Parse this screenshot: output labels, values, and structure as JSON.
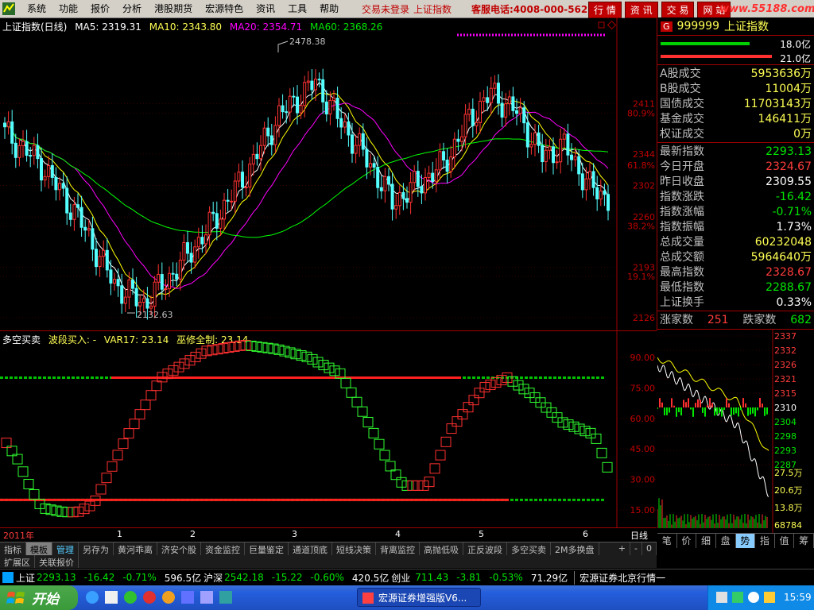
{
  "menu": {
    "items": [
      "系统",
      "功能",
      "报价",
      "分析",
      "港股期货",
      "宏源特色",
      "资讯",
      "工具",
      "帮助"
    ],
    "login_status": "交易未登录",
    "index_name": "上证指数",
    "service_phone": "客服电话:4008-000-562",
    "nav_buttons": [
      "行 情",
      "资 讯",
      "交 易",
      "网 站"
    ],
    "site": "www.55188.com"
  },
  "main_chart": {
    "legend": {
      "name": "上证指数(日线)",
      "ma5": "MA5: 2319.31",
      "ma10": "MA10: 2343.80",
      "ma20": "MA20: 2354.71",
      "ma60": "MA60: 2368.26"
    },
    "annot_high": "2478.38",
    "annot_low": "2132.63",
    "y_ticks": [
      {
        "label": "2411",
        "value": 2411
      },
      {
        "label": "80.9%",
        "value": 2398
      },
      {
        "label": "2344",
        "value": 2344
      },
      {
        "label": "61.8%",
        "value": 2329
      },
      {
        "label": "2302",
        "value": 2302
      },
      {
        "label": "2260",
        "value": 2260
      },
      {
        "label": "38.2%",
        "value": 2248
      },
      {
        "label": "2193",
        "value": 2193
      },
      {
        "label": "19.1%",
        "value": 2181
      },
      {
        "label": "2126",
        "value": 2126
      }
    ],
    "colors": {
      "up": "#ff3232",
      "down": "#54ffff",
      "ma5": "#ffffff",
      "ma10": "#ffff00",
      "ma20": "#ff00ff",
      "ma60": "#00ff00"
    }
  },
  "sub_chart": {
    "legend": {
      "name": "多空买卖",
      "b1": "波段买入: -",
      "var17": "VAR17: 23.14",
      "wu": "巫修全制: 23.14"
    },
    "y_ticks": [
      {
        "label": "90.00",
        "value": 90
      },
      {
        "label": "75.00",
        "value": 75
      },
      {
        "label": "60.00",
        "value": 60
      },
      {
        "label": "45.00",
        "value": 45
      },
      {
        "label": "30.00",
        "value": 30
      },
      {
        "label": "15.00",
        "value": 15
      }
    ]
  },
  "x_labels": [
    "2011年",
    "1",
    "2",
    "3",
    "4",
    "5",
    "6"
  ],
  "period": "日线",
  "zoom_buttons": [
    "+",
    "-",
    "0"
  ],
  "tabs": [
    "指标",
    "模板",
    "管理",
    "另存为",
    "黄河乖离",
    "济安个股",
    "资金监控",
    "巨量鉴定",
    "通道顶底",
    "短线决策",
    "背离监控",
    "高抛低吸",
    "正反波段",
    "多空买卖",
    "2M多换盘"
  ],
  "tabs2": [
    "扩展区",
    "关联报价"
  ],
  "right_panel": {
    "code_badge": "G",
    "code": "999999",
    "name": "上证指数",
    "bar1_value": "18.0亿",
    "bar2_value": "21.0亿",
    "rows_a": [
      {
        "k": "A股成交",
        "v": "5953636万",
        "c": "yellow"
      },
      {
        "k": "B股成交",
        "v": "11004万",
        "c": "yellow"
      },
      {
        "k": "国债成交",
        "v": "11703143万",
        "c": "yellow"
      },
      {
        "k": "基金成交",
        "v": "146411万",
        "c": "yellow"
      },
      {
        "k": "权证成交",
        "v": "0万",
        "c": "yellow"
      }
    ],
    "rows_b": [
      {
        "k": "最新指数",
        "v": "2293.13",
        "c": "green"
      },
      {
        "k": "今日开盘",
        "v": "2324.67",
        "c": "red"
      },
      {
        "k": "昨日收盘",
        "v": "2309.55",
        "c": "white"
      },
      {
        "k": "指数涨跌",
        "v": "-16.42",
        "c": "green"
      },
      {
        "k": "指数涨幅",
        "v": "-0.71%",
        "c": "green"
      },
      {
        "k": "指数振幅",
        "v": "1.73%",
        "c": "white"
      },
      {
        "k": "总成交量",
        "v": "60232048",
        "c": "yellow"
      },
      {
        "k": "总成交额",
        "v": "5964640万",
        "c": "yellow"
      },
      {
        "k": "最高指数",
        "v": "2328.67",
        "c": "red"
      },
      {
        "k": "最低指数",
        "v": "2288.67",
        "c": "green"
      },
      {
        "k": "上证换手",
        "v": "0.33%",
        "c": "white"
      }
    ],
    "up_label": "涨家数",
    "up_count": "251",
    "down_label": "跌家数",
    "down_count": "682",
    "mini_ticks": [
      "2337",
      "2332",
      "2326",
      "2321",
      "2315",
      "2310",
      "2304",
      "2298",
      "2293",
      "2287",
      "27.5万",
      "20.6万",
      "13.8万",
      "68784"
    ],
    "bottom_tabs": [
      "笔",
      "价",
      "细",
      "盘",
      "势",
      "指",
      "值",
      "筹"
    ]
  },
  "ticker": {
    "sh_name": "上证",
    "sh_val": "2293.13",
    "sh_chg": "-16.42",
    "sh_pct": "-0.71%",
    "sh_amt": "596.5亿",
    "hs_name": "沪深",
    "hs_val": "2542.18",
    "hs_chg": "-15.22",
    "hs_pct": "-0.60%",
    "hs_amt": "420.5亿",
    "cy_name": "创业",
    "cy_val": "711.43",
    "cy_chg": "-3.81",
    "cy_pct": "-0.53%",
    "cy_amt": "71.29亿",
    "broker": "宏源证券北京行情一"
  },
  "taskbar": {
    "start": "开始",
    "window": "宏源证券增强版V6...",
    "time": "15:59"
  }
}
